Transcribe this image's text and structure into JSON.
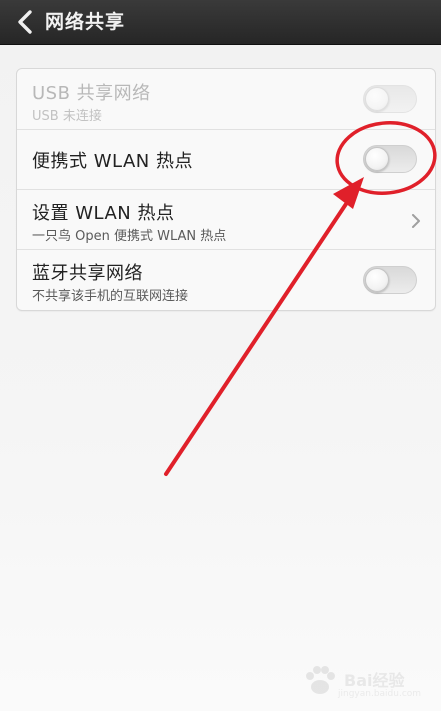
{
  "header": {
    "title": "网络共享",
    "back_icon": "chevron-left-icon"
  },
  "settings": [
    {
      "label": "USB 共享网络",
      "subtitle": "USB 未连接",
      "control": "toggle",
      "state": "off",
      "enabled": false
    },
    {
      "label": "便携式 WLAN 热点",
      "subtitle": "",
      "control": "toggle",
      "state": "off",
      "enabled": true
    },
    {
      "label": "设置 WLAN 热点",
      "subtitle": "一只鸟 Open 便携式 WLAN 热点",
      "control": "chevron",
      "icon": "chevron-right-icon",
      "enabled": true
    },
    {
      "label": "蓝牙共享网络",
      "subtitle": "不共享该手机的互联网连接",
      "control": "toggle",
      "state": "off",
      "enabled": true
    }
  ],
  "annotation": {
    "color": "#e0202a",
    "shapes": [
      "circle-highlight",
      "arrow"
    ]
  },
  "watermark": {
    "brand": "Bai经验",
    "url": "jingyan.baidu.com"
  }
}
